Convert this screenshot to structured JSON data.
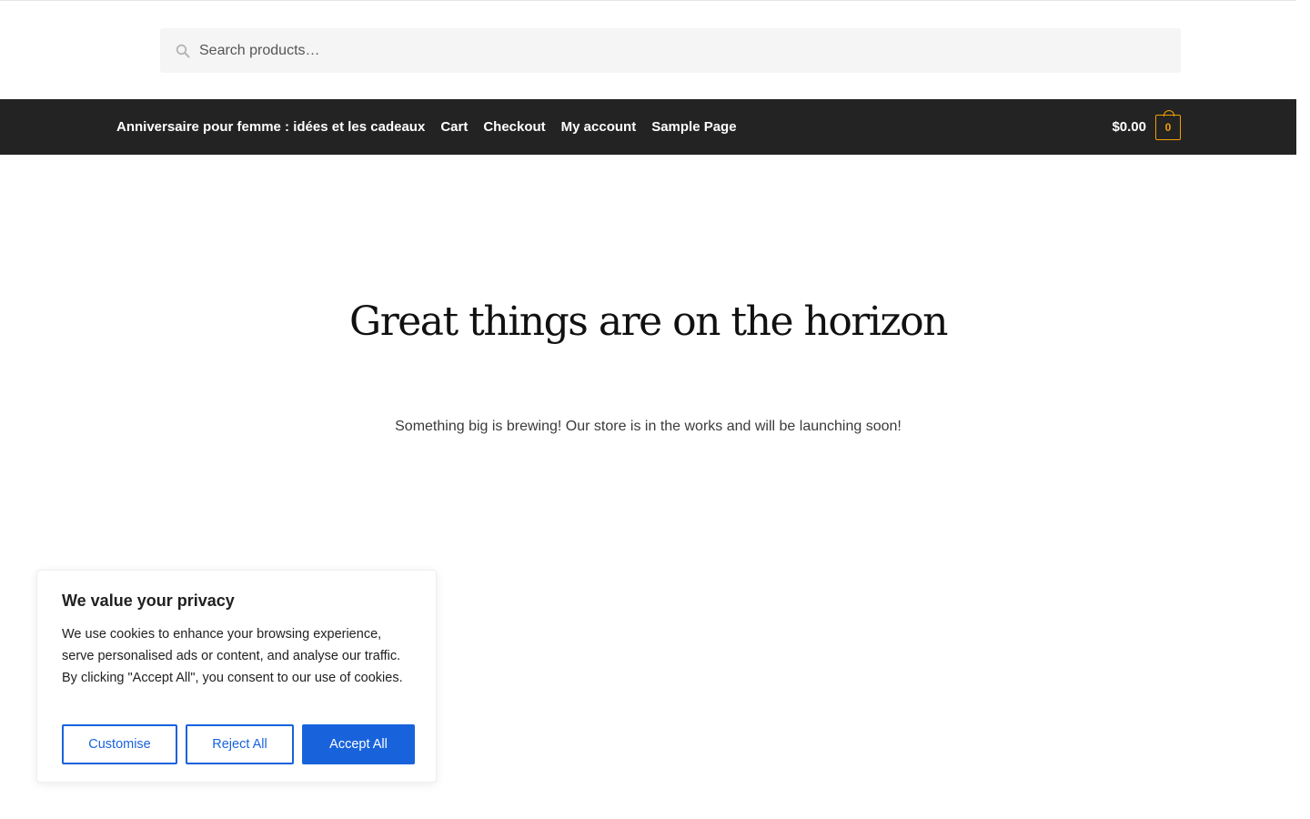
{
  "search": {
    "placeholder": "Search products…"
  },
  "nav": {
    "items": [
      {
        "label": "Anniversaire pour femme : idées et les cadeaux"
      },
      {
        "label": "Cart"
      },
      {
        "label": "Checkout"
      },
      {
        "label": "My account"
      },
      {
        "label": "Sample Page"
      }
    ]
  },
  "cart": {
    "total": "$0.00",
    "count": "0"
  },
  "hero": {
    "title": "Great things are on the horizon",
    "subtitle": "Something big is brewing! Our store is in the works and will be launching soon!"
  },
  "cookie": {
    "title": "We value your privacy",
    "text": "We use cookies to enhance your browsing experience, serve personalised ads or content, and analyse our traffic. By clicking \"Accept All\", you consent to our use of cookies.",
    "buttons": {
      "customise": "Customise",
      "reject": "Reject All",
      "accept": "Accept All"
    }
  },
  "colors": {
    "navbar_bg": "#232323",
    "cart_accent": "#f0a000",
    "button_blue": "#1863dc"
  },
  "icons": {
    "search": "search-icon",
    "cart": "cart-bag-icon"
  }
}
